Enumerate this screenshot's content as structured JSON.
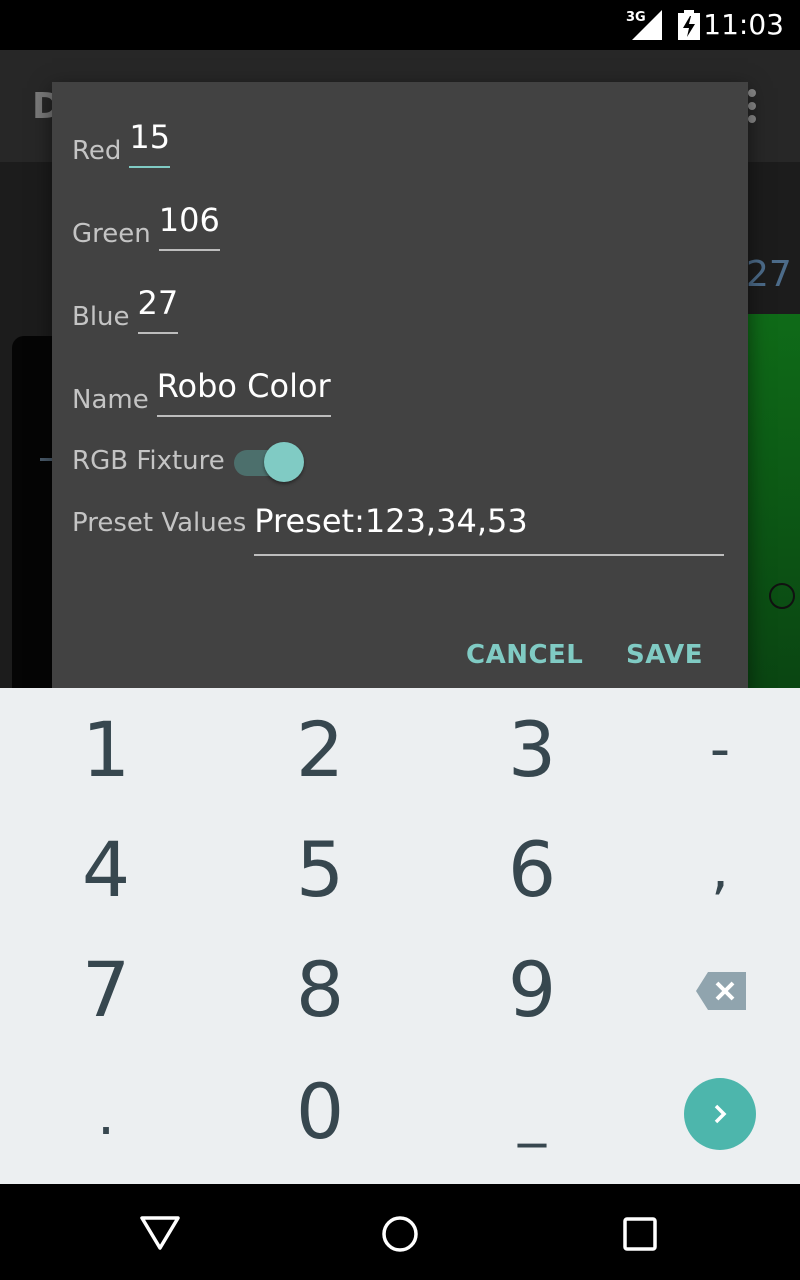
{
  "status_bar": {
    "time": "11:03",
    "network": "3G"
  },
  "background": {
    "title_partial": "D",
    "right_value": "27"
  },
  "dialog": {
    "fields": {
      "red": {
        "label": "Red",
        "value": "15"
      },
      "green": {
        "label": "Green",
        "value": "106"
      },
      "blue": {
        "label": "Blue",
        "value": "27"
      },
      "name": {
        "label": "Name",
        "value": "Robo Color"
      }
    },
    "rgb_fixture": {
      "label": "RGB Fixture",
      "on": true
    },
    "preset": {
      "label": "Preset Values",
      "value": "Preset:123,34,53"
    },
    "buttons": {
      "cancel": "CANCEL",
      "save": "SAVE"
    }
  },
  "keyboard": {
    "keys": [
      "1",
      "2",
      "3",
      "-",
      "4",
      "5",
      "6",
      ",",
      "7",
      "8",
      "9",
      ".",
      "0",
      "_"
    ]
  },
  "colors": {
    "accent": "#80cbc4",
    "enter_key": "#4db6ac",
    "dialog_bg": "#424242",
    "keyboard_bg": "#eceff1"
  }
}
